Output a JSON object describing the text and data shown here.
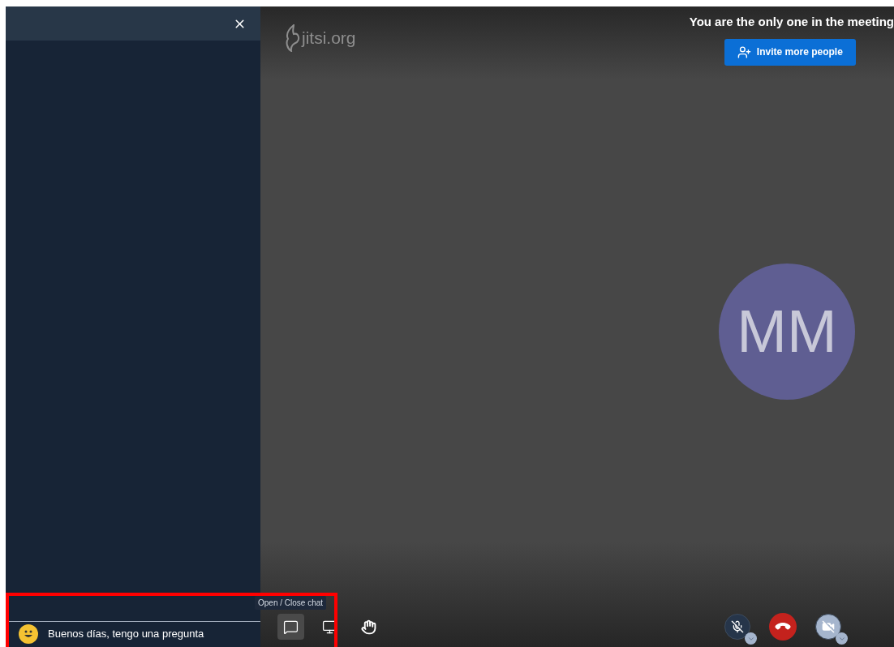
{
  "chat": {
    "input": {
      "value": "Buenos días, tengo una pregunta"
    }
  },
  "meeting": {
    "logo": "jitsi.org",
    "notice": "You are the only one in the meeting",
    "invite_button": "Invite more people",
    "avatar": {
      "initials": "MM"
    }
  },
  "toolbar": {
    "tooltip": "Open / Close chat",
    "left": [
      {
        "kind": "chat",
        "selected": true
      },
      {
        "kind": "screen",
        "selected": false
      },
      {
        "kind": "hand",
        "selected": false
      }
    ],
    "right": [
      {
        "kind": "mic",
        "muted": true
      },
      {
        "kind": "hangup"
      },
      {
        "kind": "camera",
        "muted": true
      }
    ]
  }
}
